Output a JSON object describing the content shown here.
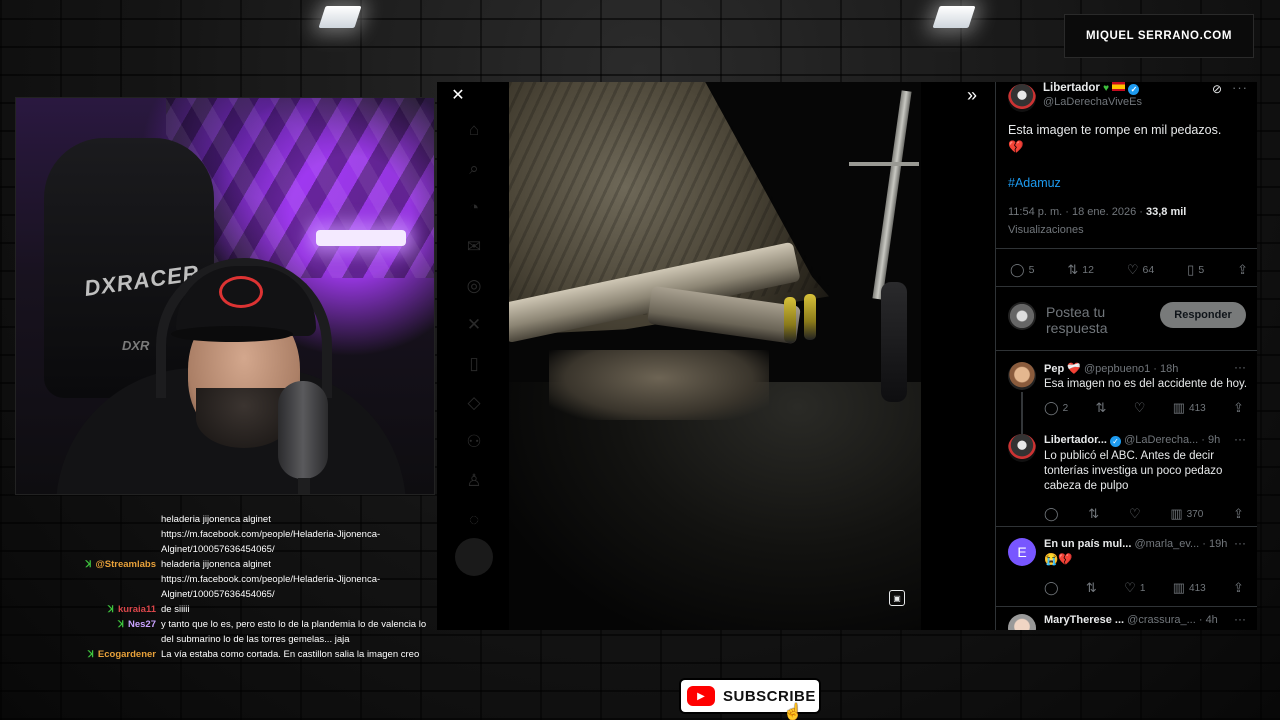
{
  "brand": {
    "watermark": "MIQUEL SERRANO.COM"
  },
  "webcam": {
    "chair_logo": "DXRACER",
    "chair_logo_small": "DXR"
  },
  "chat": {
    "messages": [
      {
        "user": "",
        "text": "heladeria jijonenca alginet"
      },
      {
        "user": "",
        "text": "https://m.facebook.com/people/Heladeria-Jijonenca-Alginet/100057636454065/"
      },
      {
        "user": "@Streamlabs",
        "user_color": "#e8a13a",
        "badge": true,
        "text": "heladeria jijonenca alginet"
      },
      {
        "user": "",
        "text": "https://m.facebook.com/people/Heladeria-Jijonenca-Alginet/100057636454065/"
      },
      {
        "user": "kuraia11",
        "user_color": "#d9464a",
        "badge": true,
        "text": "de siiiii"
      },
      {
        "user": "Nes27",
        "user_color": "#c9a2ff",
        "badge": true,
        "text": "y tanto que lo es, pero esto lo de la plandemia lo de valencia lo del submarino lo de las torres gemelas... jaja"
      },
      {
        "user": "Ecogardener",
        "user_color": "#e8a13a",
        "badge": true,
        "text": "La vía estaba como cortada. En castillon salia la imagen creo"
      }
    ]
  },
  "viewer": {
    "close_icon": "close-icon",
    "expand_icon": "expand-icon",
    "alt_badge": "alt-badge-icon"
  },
  "tweet": {
    "author_name": "Libertador",
    "author_handle": "@LaDerechaViveEs",
    "text": "Esta imagen te rompe en mil pedazos.",
    "text_emoji": "💔",
    "hashtag": "#Adamuz",
    "timestamp": "11:54 p. m. · 18 ene. 2026 · ",
    "views_count": "33,8 mil",
    "views_label": "Visualizaciones",
    "actions": {
      "replies": "5",
      "reposts": "12",
      "likes": "64",
      "bookmarks": "5"
    },
    "reply_placeholder": "Postea tu respuesta",
    "reply_button": "Responder"
  },
  "replies": [
    {
      "name": "Pep",
      "name_suffix": "❤️‍🩹",
      "handle": "@pepbueno1 · 18h",
      "text": "Esa imagen no es del accidente de hoy.",
      "actions": {
        "replies": "2",
        "reposts": "",
        "likes": "",
        "views": "413"
      }
    },
    {
      "name": "Libertador...",
      "handle": "@LaDerecha... · 9h",
      "text": "Lo publicó el ABC. Antes de decir tonterías investiga un poco pedazo cabeza de pulpo",
      "actions": {
        "replies": "",
        "reposts": "",
        "likes": "",
        "views": "370"
      }
    },
    {
      "name": "En un país mul...",
      "handle": "@marla_ev... · 19h",
      "avatar_letter": "E",
      "text": "😭💔",
      "actions": {
        "replies": "",
        "reposts": "",
        "likes": "1",
        "views": "413"
      }
    },
    {
      "name": "MaryTherese ...",
      "handle": "@crassura_... · 4h",
      "text": ""
    }
  ],
  "overlay": {
    "subscribe_label": "SUBSCRIBE"
  }
}
